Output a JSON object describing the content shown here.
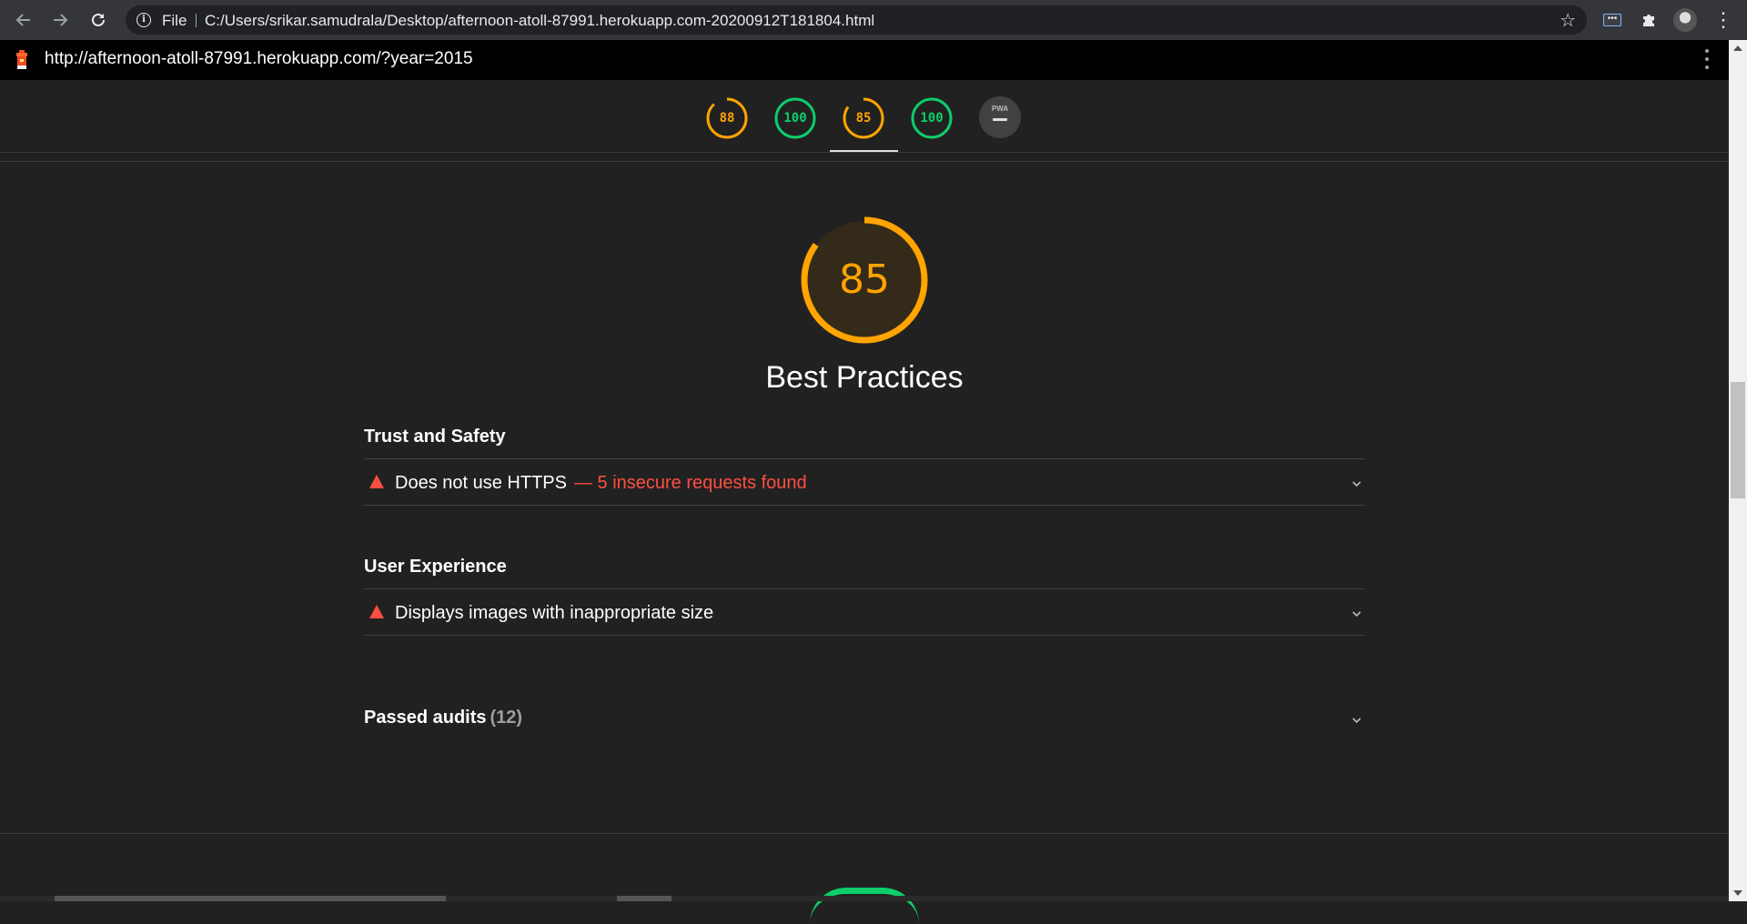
{
  "browser": {
    "omnibox_scheme": "File",
    "omnibox_url": "C:/Users/srikar.samudrala/Desktop/afternoon-atoll-87991.herokuapp.com-20200912T181804.html",
    "icons": [
      "back-arrow-icon",
      "forward-arrow-icon",
      "reload-icon",
      "info-icon",
      "star-icon",
      "extension-dots-icon",
      "puzzle-icon",
      "avatar",
      "kebab-menu-icon"
    ]
  },
  "report": {
    "url": "http://afternoon-atoll-87991.herokuapp.com/?year=2015",
    "icons": [
      "lighthouse-icon",
      "kebab-menu-icon"
    ]
  },
  "score_gauges": [
    {
      "value": "88",
      "score": 0.88,
      "color": "#ffa400"
    },
    {
      "value": "100",
      "score": 1.0,
      "color": "#0cce6b"
    },
    {
      "value": "85",
      "score": 0.85,
      "color": "#ffa400",
      "selected": true
    },
    {
      "value": "100",
      "score": 1.0,
      "color": "#0cce6b"
    }
  ],
  "pwa_gauge": {
    "label": "PWA"
  },
  "category": {
    "score": "85",
    "score_fraction": 0.85,
    "title": "Best Practices",
    "color": "#ffa400"
  },
  "groups": [
    {
      "title": "Trust and Safety",
      "audits": [
        {
          "title": "Does not use HTTPS",
          "display_value": "— 5 insecure requests found"
        }
      ]
    },
    {
      "title": "User Experience",
      "audits": [
        {
          "title": "Displays images with inappropriate size",
          "display_value": ""
        }
      ]
    }
  ],
  "passed_audits": {
    "label": "Passed audits",
    "count": "(12)"
  },
  "colors": {
    "fail": "#ff4e42",
    "average": "#ffa400",
    "pass": "#0cce6b",
    "background": "#212121"
  }
}
